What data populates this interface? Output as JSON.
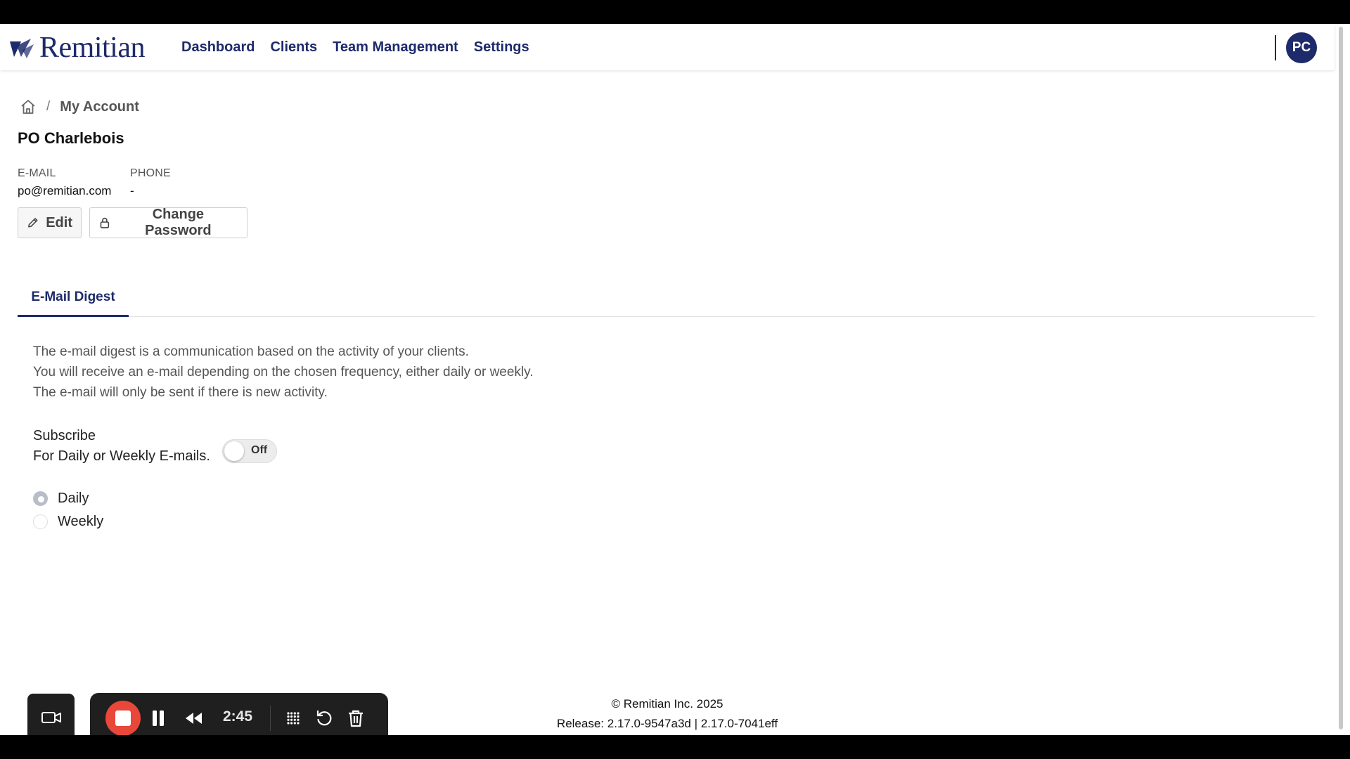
{
  "app": {
    "logo_text": "Remitian",
    "nav": [
      "Dashboard",
      "Clients",
      "Team Management",
      "Settings"
    ],
    "avatar_initials": "PC",
    "brand_color": "#1d2a6b"
  },
  "breadcrumb": {
    "home_icon": "home-icon",
    "separator": "/",
    "current": "My Account"
  },
  "profile": {
    "name": "PO Charlebois",
    "email_label": "E-MAIL",
    "email_value": "po@remitian.com",
    "phone_label": "PHONE",
    "phone_value": "-",
    "edit_label": "Edit",
    "change_password_label": "Change Password"
  },
  "tabs": [
    {
      "label": "E-Mail Digest",
      "active": true
    }
  ],
  "digest": {
    "description": [
      "The e-mail digest is a communication based on the activity of your clients.",
      "You will receive an e-mail depending on the chosen frequency, either daily or weekly.",
      "The e-mail will only be sent if there is new activity."
    ],
    "subscribe_title": "Subscribe",
    "subscribe_subtitle": "For Daily or Weekly E-mails.",
    "toggle_label": "Off",
    "toggle_on": false,
    "frequency_options": [
      {
        "label": "Daily",
        "selected": true
      },
      {
        "label": "Weekly",
        "selected": false
      }
    ]
  },
  "footer": {
    "copyright": "© Remitian Inc. 2025",
    "release": "Release: 2.17.0-9547a3d | 2.17.0-7041eff"
  },
  "recorder": {
    "elapsed": "2:45",
    "stop_color": "#e8473a",
    "icons": [
      "camera-icon",
      "stop-icon",
      "pause-icon",
      "rewind-icon",
      "grid-icon",
      "restart-icon",
      "trash-icon"
    ]
  }
}
